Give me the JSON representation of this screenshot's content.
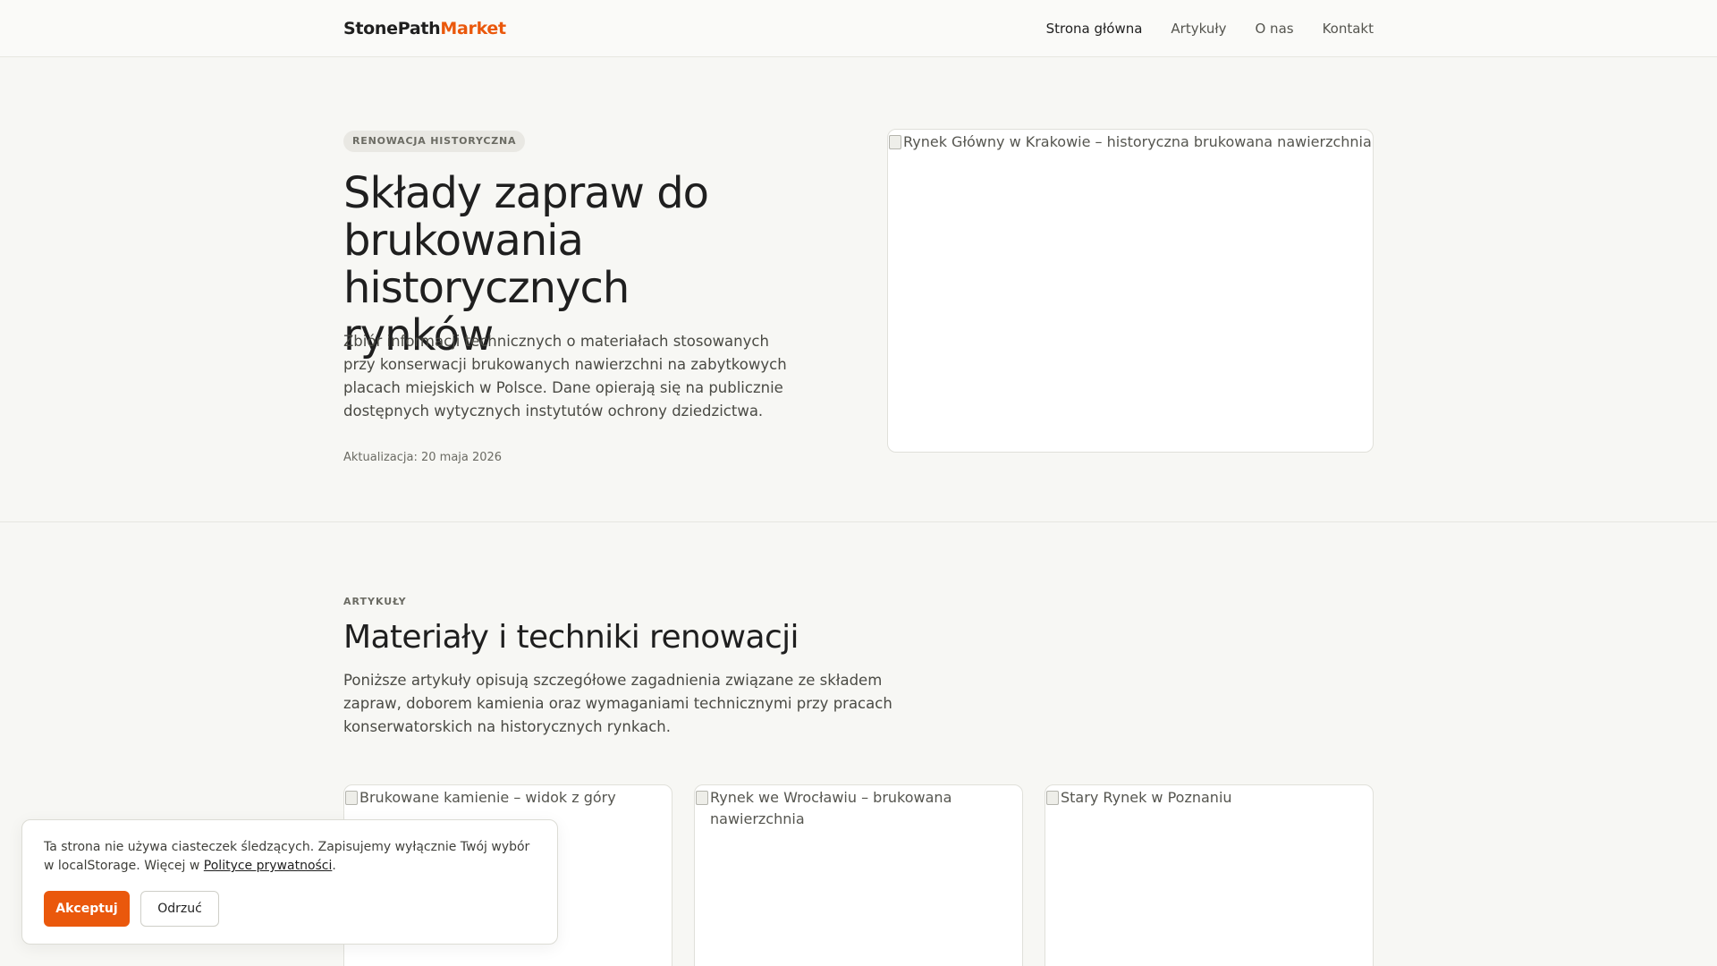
{
  "header": {
    "logo_primary": "StonePath",
    "logo_accent": "Market",
    "nav": [
      {
        "label": "Strona główna",
        "active": true
      },
      {
        "label": "Artykuły",
        "active": false
      },
      {
        "label": "O nas",
        "active": false
      },
      {
        "label": "Kontakt",
        "active": false
      }
    ]
  },
  "hero": {
    "tag": "RENOWACJA HISTORYCZNA",
    "title": "Składy zapraw do brukowania historycznych rynków",
    "lead": "Zbiór informacji technicznych o materiałach stosowanych przy konserwacji brukowanych nawierzchni na zabytkowych placach miejskich w Polsce. Dane opierają się na publicznie dostępnych wytycznych instytutów ochrony dziedzictwa.",
    "date": "Aktualizacja: 20 maja 2026",
    "image_alt": "Rynek Główny w Krakowie – historyczna brukowana nawierzchnia"
  },
  "articles": {
    "eyebrow": "ARTYKUŁY",
    "title": "Materiały i techniki renowacji",
    "lead": "Poniższe artykuły opisują szczegółowe zagadnienia związane ze składem zapraw, doborem kamienia oraz wymaganiami technicznymi przy pracach konserwatorskich na historycznych rynkach.",
    "cards": [
      {
        "image_alt": "Brukowane kamienie – widok z góry"
      },
      {
        "image_alt": "Rynek we Wrocławiu – brukowana nawierzchnia"
      },
      {
        "image_alt": "Stary Rynek w Poznaniu"
      }
    ]
  },
  "cookie": {
    "text": "Ta strona nie używa ciasteczek śledzących. Zapisujemy wyłącznie Twój wybór w localStorage. Więcej w",
    "link_label": "Polityce prywatności",
    "text_end": ".",
    "accept_label": "Akceptuj",
    "reject_label": "Odrzuć"
  },
  "colors": {
    "accent": "#ea580c",
    "background": "#f7f7f4",
    "text": "#1f1f1f"
  }
}
